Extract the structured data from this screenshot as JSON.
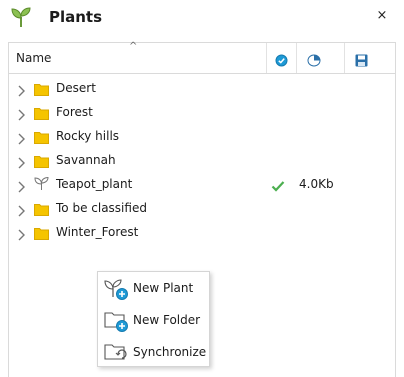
{
  "window": {
    "title": "Plants",
    "close_label": "×"
  },
  "table": {
    "columns": {
      "name": "Name",
      "sort_indicator": "^"
    },
    "rows": [
      {
        "icon": "folder-icon",
        "label": "Desert",
        "status": "",
        "size": ""
      },
      {
        "icon": "folder-icon",
        "label": "Forest",
        "status": "",
        "size": ""
      },
      {
        "icon": "folder-icon",
        "label": "Rocky hills",
        "status": "",
        "size": ""
      },
      {
        "icon": "folder-icon",
        "label": "Savannah",
        "status": "",
        "size": ""
      },
      {
        "icon": "plant-icon",
        "label": "Teapot_plant",
        "status": "synced",
        "size": "4.0Kb"
      },
      {
        "icon": "folder-icon",
        "label": "To be classified",
        "status": "",
        "size": ""
      },
      {
        "icon": "folder-icon",
        "label": "Winter_Forest",
        "status": "",
        "size": ""
      }
    ]
  },
  "context_menu": {
    "items": [
      {
        "icon": "new-plant-icon",
        "label": "New Plant"
      },
      {
        "icon": "new-folder-icon",
        "label": "New Folder"
      },
      {
        "icon": "synchronize-icon",
        "label": "Synchronize"
      }
    ]
  },
  "colors": {
    "folder": "#f5c400",
    "accent": "#1e9ad6",
    "check": "#4caf50",
    "border": "#dadada"
  }
}
